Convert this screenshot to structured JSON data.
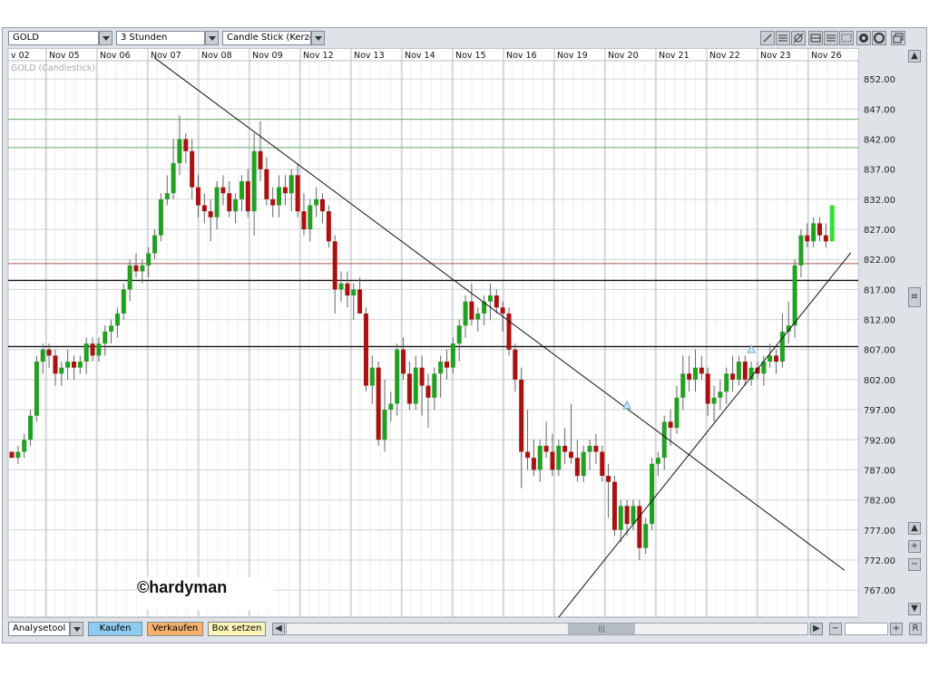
{
  "toolbar": {
    "symbol": "GOLD",
    "period": "3 Stunden",
    "chart_type": "Candle Stick (Kerze",
    "icons": [
      "pencil-icon",
      "horizontal-lines-icon",
      "fibonacci-icon",
      "grid-icon",
      "list-icon",
      "grid-dots-icon",
      "settings-icon",
      "lifebuoy-icon",
      "refresh-icon",
      "restore-window-icon"
    ]
  },
  "bottom": {
    "analysetool": "Analysetool",
    "kaufen": "Kaufen",
    "verkaufen": "Verkaufen",
    "box_setzen": "Box setzen",
    "scroll_grip": "|||",
    "zoom_out": "−",
    "zoom_in": "+",
    "reset": "R"
  },
  "watermark": "©hardyman",
  "colors": {
    "up": "#22a022",
    "down": "#aa1111",
    "grid": "#d0d4d8",
    "green_level": "#66aa66",
    "red_level": "#aa5555",
    "last_candle": "#33dd33"
  },
  "chart_data": {
    "type": "candlestick",
    "subtitle": "GOLD (Candlestick)",
    "ylabel": "",
    "ylim": [
      762.5,
      857.0
    ],
    "y_ticks": [
      852.0,
      847.0,
      842.0,
      837.0,
      832.0,
      827.0,
      822.0,
      817.0,
      812.0,
      807.0,
      802.0,
      797.0,
      792.0,
      787.0,
      782.0,
      777.0,
      772.0,
      767.0
    ],
    "x_ticks": [
      "v 02",
      "Nov 05",
      "Nov 06",
      "Nov 07",
      "Nov 08",
      "Nov 09",
      "Nov 12",
      "Nov 13",
      "Nov 14",
      "Nov 15",
      "Nov 16",
      "Nov 19",
      "Nov 20",
      "Nov 21",
      "Nov 22",
      "Nov 23",
      "Nov 26"
    ],
    "grid": true,
    "horizontal_levels": [
      {
        "value": 845.3,
        "color": "green"
      },
      {
        "value": 840.6,
        "color": "green"
      },
      {
        "value": 821.3,
        "color": "red"
      },
      {
        "value": 818.5,
        "color": "black"
      },
      {
        "value": 807.5,
        "color": "black"
      }
    ],
    "trendlines": [
      {
        "from": {
          "bar": 23,
          "price": 855.5
        },
        "to": {
          "bar": 134,
          "price": 770.3
        }
      },
      {
        "from": {
          "bar": 88,
          "price": 762.5
        },
        "to": {
          "bar": 135,
          "price": 823.1
        }
      }
    ],
    "markers": [
      {
        "bar": 99,
        "price": 797.5,
        "shape": "up-arrow"
      },
      {
        "bar": 119,
        "price": 806.8,
        "shape": "up-arrow"
      }
    ],
    "candles": [
      [
        790,
        790,
        789,
        789
      ],
      [
        789,
        791,
        788,
        790
      ],
      [
        790,
        793,
        789,
        792
      ],
      [
        792,
        797,
        791,
        796
      ],
      [
        796,
        806,
        795,
        805
      ],
      [
        805,
        808,
        803,
        807
      ],
      [
        807,
        808,
        804,
        806
      ],
      [
        806,
        807,
        801,
        803
      ],
      [
        803,
        805,
        801,
        804
      ],
      [
        804,
        807,
        802,
        805
      ],
      [
        805,
        806,
        802,
        804
      ],
      [
        804,
        806,
        803,
        805
      ],
      [
        805,
        809,
        803,
        808
      ],
      [
        808,
        809,
        805,
        806
      ],
      [
        806,
        809,
        805,
        808
      ],
      [
        808,
        811,
        806,
        810
      ],
      [
        810,
        812,
        808,
        811
      ],
      [
        811,
        814,
        809,
        813
      ],
      [
        813,
        818,
        812,
        817
      ],
      [
        817,
        822,
        815,
        821
      ],
      [
        821,
        823,
        819,
        820
      ],
      [
        820,
        822,
        818,
        821
      ],
      [
        821,
        824,
        819,
        823
      ],
      [
        823,
        827,
        822,
        826
      ],
      [
        826,
        833,
        825,
        832
      ],
      [
        832,
        836,
        831,
        833
      ],
      [
        833,
        842,
        832,
        838
      ],
      [
        838,
        846,
        836,
        842
      ],
      [
        842,
        843,
        838,
        840
      ],
      [
        840,
        842,
        832,
        834
      ],
      [
        834,
        836,
        829,
        831
      ],
      [
        831,
        833,
        828,
        830
      ],
      [
        830,
        832,
        825,
        829
      ],
      [
        829,
        835,
        827,
        834
      ],
      [
        834,
        836,
        831,
        833
      ],
      [
        833,
        835,
        829,
        830
      ],
      [
        830,
        833,
        828,
        832
      ],
      [
        832,
        836,
        830,
        835
      ],
      [
        835,
        837,
        829,
        830
      ],
      [
        830,
        843,
        826,
        840
      ],
      [
        840,
        845,
        835,
        837
      ],
      [
        837,
        839,
        831,
        832
      ],
      [
        832,
        834,
        829,
        831
      ],
      [
        831,
        836,
        829,
        834
      ],
      [
        834,
        836,
        831,
        833
      ],
      [
        833,
        837,
        830,
        836
      ],
      [
        836,
        838,
        829,
        830
      ],
      [
        830,
        833,
        826,
        827
      ],
      [
        827,
        832,
        825,
        831
      ],
      [
        831,
        834,
        829,
        832
      ],
      [
        832,
        833,
        828,
        830
      ],
      [
        830,
        831,
        824,
        825
      ],
      [
        825,
        826,
        813,
        817
      ],
      [
        817,
        820,
        815,
        818
      ],
      [
        818,
        820,
        814,
        816
      ],
      [
        816,
        818,
        812,
        817
      ],
      [
        817,
        819,
        813,
        813
      ],
      [
        813,
        814,
        800,
        801
      ],
      [
        801,
        806,
        798,
        804
      ],
      [
        804,
        805,
        791,
        792
      ],
      [
        792,
        802,
        790,
        797
      ],
      [
        797,
        800,
        795,
        798
      ],
      [
        798,
        808,
        796,
        807
      ],
      [
        807,
        809,
        802,
        803
      ],
      [
        803,
        805,
        797,
        798
      ],
      [
        798,
        806,
        797,
        804
      ],
      [
        804,
        806,
        796,
        801
      ],
      [
        801,
        803,
        794,
        799
      ],
      [
        799,
        804,
        797,
        803
      ],
      [
        803,
        806,
        799,
        805
      ],
      [
        805,
        807,
        802,
        804
      ],
      [
        804,
        809,
        803,
        808
      ],
      [
        808,
        812,
        805,
        811
      ],
      [
        811,
        816,
        809,
        815
      ],
      [
        815,
        818,
        811,
        812
      ],
      [
        812,
        814,
        810,
        813
      ],
      [
        813,
        816,
        811,
        815
      ],
      [
        815,
        818,
        812,
        816
      ],
      [
        816,
        817,
        813,
        814
      ],
      [
        814,
        815,
        810,
        813
      ],
      [
        813,
        814,
        806,
        807
      ],
      [
        807,
        808,
        800,
        802
      ],
      [
        802,
        804,
        784,
        790
      ],
      [
        790,
        797,
        787,
        789
      ],
      [
        789,
        792,
        786,
        787
      ],
      [
        787,
        792,
        785,
        791
      ],
      [
        791,
        795,
        789,
        790
      ],
      [
        790,
        793,
        786,
        787
      ],
      [
        787,
        792,
        786,
        791
      ],
      [
        791,
        794,
        788,
        790
      ],
      [
        790,
        798,
        788,
        789
      ],
      [
        789,
        792,
        785,
        786
      ],
      [
        786,
        791,
        785,
        790
      ],
      [
        790,
        792,
        787,
        791
      ],
      [
        791,
        793,
        788,
        790
      ],
      [
        790,
        791,
        785,
        786
      ],
      [
        786,
        788,
        779,
        785
      ],
      [
        785,
        786,
        776,
        777
      ],
      [
        777,
        782,
        775,
        781
      ],
      [
        781,
        782,
        776,
        778
      ],
      [
        778,
        782,
        777,
        781
      ],
      [
        781,
        782,
        772,
        774
      ],
      [
        774,
        779,
        773,
        778
      ],
      [
        778,
        789,
        777,
        788
      ],
      [
        788,
        790,
        786,
        789
      ],
      [
        789,
        796,
        787,
        795
      ],
      [
        795,
        797,
        791,
        794
      ],
      [
        794,
        801,
        793,
        799
      ],
      [
        799,
        806,
        797,
        803
      ],
      [
        803,
        806,
        800,
        802
      ],
      [
        802,
        807,
        800,
        804
      ],
      [
        804,
        806,
        802,
        803
      ],
      [
        803,
        804,
        796,
        798
      ],
      [
        798,
        801,
        795,
        799
      ],
      [
        799,
        802,
        797,
        800
      ],
      [
        800,
        804,
        798,
        803
      ],
      [
        803,
        806,
        800,
        802
      ],
      [
        802,
        806,
        801,
        805
      ],
      [
        805,
        806,
        801,
        802
      ],
      [
        802,
        805,
        801,
        804
      ],
      [
        804,
        805,
        802,
        803
      ],
      [
        803,
        806,
        801,
        805
      ],
      [
        805,
        808,
        804,
        806
      ],
      [
        806,
        807,
        803,
        805
      ],
      [
        805,
        813,
        804,
        810
      ],
      [
        810,
        815,
        808,
        811
      ],
      [
        811,
        822,
        809,
        821
      ],
      [
        821,
        827,
        819,
        826
      ],
      [
        826,
        828,
        824,
        825
      ],
      [
        825,
        829,
        824,
        828
      ],
      [
        828,
        829,
        825,
        826
      ],
      [
        826,
        828,
        824,
        825
      ],
      [
        825,
        831,
        825,
        831
      ]
    ]
  }
}
